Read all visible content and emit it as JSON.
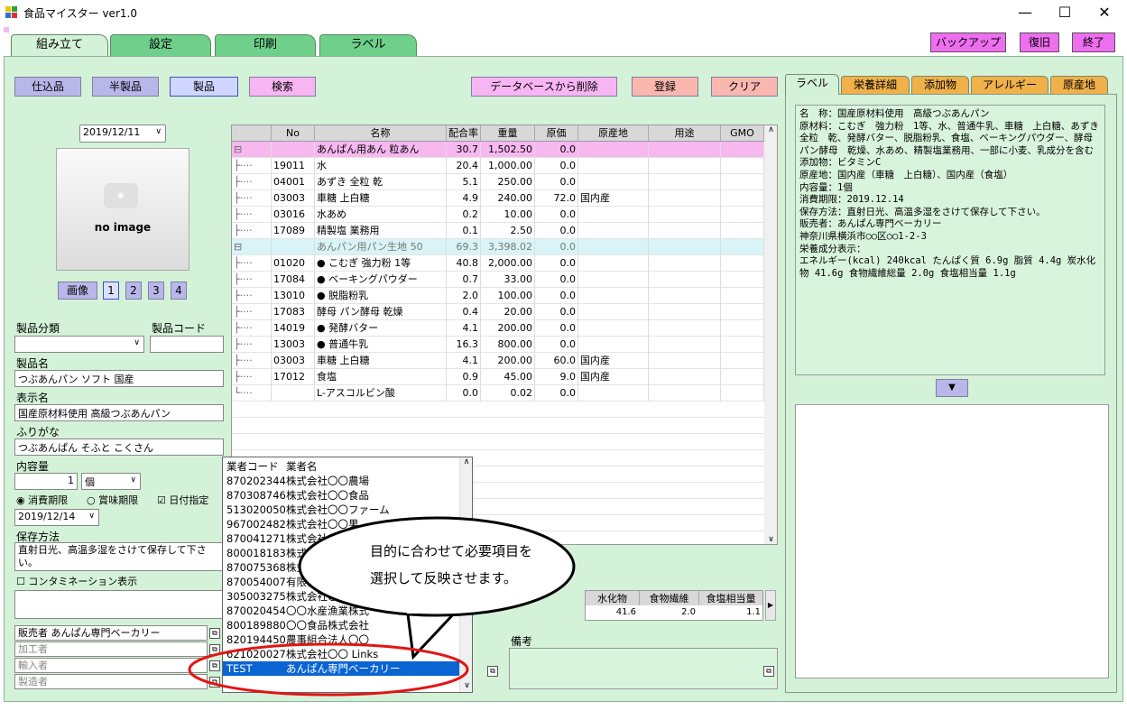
{
  "window": {
    "title": "食品マイスター ver1.0",
    "minimize": "—",
    "maximize": "☐",
    "close": "✕"
  },
  "tabs": [
    "組み立て",
    "設定",
    "印刷",
    "ラベル"
  ],
  "top_buttons": {
    "backup": "バックアップ",
    "restore": "復旧",
    "exit": "終了"
  },
  "left_buttons": [
    "仕込品",
    "半製品",
    "製品",
    "検索"
  ],
  "action_buttons": {
    "delete": "データベースから削除",
    "register": "登録",
    "clear": "クリア"
  },
  "date": "2019/12/11",
  "image": {
    "placeholder": "no image",
    "button": "画像",
    "pages": [
      "1",
      "2",
      "3",
      "4"
    ]
  },
  "form": {
    "category_label": "製品分類",
    "category_value": "",
    "code_label": "製品コード",
    "code_value": "",
    "name_label": "製品名",
    "name_value": "つぶあんパン ソフト 国産",
    "display_label": "表示名",
    "display_value": "国産原材料使用 高級つぶあんパン",
    "furigana_label": "ふりがな",
    "furigana_value": "つぶあんぱん そふと こくさん",
    "content_label": "内容量",
    "content_qty": "1",
    "content_unit": "個",
    "expiry_consume": "消費期限",
    "expiry_best": "賞味期限",
    "date_specify": "日付指定",
    "expiry_date": "2019/12/14",
    "storage_label": "保存方法",
    "storage_value": "直射日光、高温多湿をさけて保存して下さい。",
    "contamination_label": "コンタミネーション表示",
    "seller": "販売者 あんぱん専門ベーカリー",
    "processor": "加工者",
    "importer": "輸入者",
    "manufacturer": "製造者"
  },
  "grid": {
    "headers": [
      "No",
      "名称",
      "配合率",
      "重量",
      "原価",
      "原産地",
      "用途",
      "GMO"
    ],
    "rows": [
      {
        "type": "group1",
        "no": "",
        "name": "あんぱん用あん 粒あん",
        "rate": "30.7",
        "weight": "1,502.50",
        "cost": "0.0",
        "origin": ""
      },
      {
        "type": "child",
        "no": "19011",
        "name": "水",
        "rate": "20.4",
        "weight": "1,000.00",
        "cost": "0.0",
        "origin": ""
      },
      {
        "type": "child",
        "no": "04001",
        "name": "あずき 全粒 乾",
        "rate": "5.1",
        "weight": "250.00",
        "cost": "0.0",
        "origin": ""
      },
      {
        "type": "child",
        "no": "03003",
        "name": "車糖 上白糖",
        "rate": "4.9",
        "weight": "240.00",
        "cost": "72.0",
        "origin": "国内産"
      },
      {
        "type": "child",
        "no": "03016",
        "name": "水あめ",
        "rate": "0.2",
        "weight": "10.00",
        "cost": "0.0",
        "origin": ""
      },
      {
        "type": "child",
        "no": "17089",
        "name": "精製塩 業務用",
        "rate": "0.1",
        "weight": "2.50",
        "cost": "0.0",
        "origin": ""
      },
      {
        "type": "group2",
        "no": "",
        "name": "あんパン用パン生地 50",
        "rate": "69.3",
        "weight": "3,398.02",
        "cost": "0.0",
        "origin": ""
      },
      {
        "type": "child",
        "no": "01020",
        "name": "● こむぎ 強力粉 1等",
        "rate": "40.8",
        "weight": "2,000.00",
        "cost": "0.0",
        "origin": ""
      },
      {
        "type": "child",
        "no": "17084",
        "name": "● ベーキングパウダー",
        "rate": "0.7",
        "weight": "33.00",
        "cost": "0.0",
        "origin": ""
      },
      {
        "type": "child",
        "no": "13010",
        "name": "● 脱脂粉乳",
        "rate": "2.0",
        "weight": "100.00",
        "cost": "0.0",
        "origin": ""
      },
      {
        "type": "child",
        "no": "17083",
        "name": "酵母 パン酵母 乾燥",
        "rate": "0.4",
        "weight": "20.00",
        "cost": "0.0",
        "origin": ""
      },
      {
        "type": "child",
        "no": "14019",
        "name": "● 発酵バター",
        "rate": "4.1",
        "weight": "200.00",
        "cost": "0.0",
        "origin": ""
      },
      {
        "type": "child",
        "no": "13003",
        "name": "● 普通牛乳",
        "rate": "16.3",
        "weight": "800.00",
        "cost": "0.0",
        "origin": ""
      },
      {
        "type": "child",
        "no": "03003",
        "name": "車糖 上白糖",
        "rate": "4.1",
        "weight": "200.00",
        "cost": "60.0",
        "origin": "国内産"
      },
      {
        "type": "child",
        "no": "17012",
        "name": "食塩",
        "rate": "0.9",
        "weight": "45.00",
        "cost": "9.0",
        "origin": "国内産"
      },
      {
        "type": "child-last",
        "no": "",
        "name": "L-アスコルビン酸",
        "rate": "0.0",
        "weight": "0.02",
        "cost": "0.0",
        "origin": ""
      }
    ]
  },
  "nutrition": {
    "headers": [
      "水化物",
      "食物繊維",
      "食塩相当量"
    ],
    "values": [
      "41.6",
      "2.0",
      "1.1"
    ]
  },
  "memo_label": "備考",
  "right_tabs": [
    "ラベル",
    "栄養詳細",
    "添加物",
    "アレルギー",
    "原産地"
  ],
  "label_text": "名　称：国産原材料使用　高級つぶあんパン\n原材料：こむぎ　強力粉　1等、水、普通牛乳、車糖　上白糖、あずき　全粒　乾、発酵バター、脱脂粉乳、食塩、ベーキングパウダー、酵母　パン酵母　乾燥、水あめ、精製塩業務用、一部に小麦、乳成分を含む\n添加物：ビタミンC\n原産地：国内産（車糖　上白糖）、国内産（食塩）\n内容量：1個\n消費期限：2019.12.14\n保存方法：直射日光、高温多湿をさけて保存して下さい。\n販売者：あんぱん専門ベーカリー\n神奈川県横浜市○○区○○1-2-3\n栄養成分表示：\nエネルギー(kcal) 240kcal たんぱく質 6.9g 脂質 4.4g 炭水化物 41.6g 食物繊維総量 2.0g 食塩相当量 1.1g",
  "popup": {
    "col_code": "業者コード",
    "col_name": "業者名",
    "rows": [
      [
        "870202344",
        "株式会社〇〇農場"
      ],
      [
        "870308746",
        "株式会社〇〇食品"
      ],
      [
        "513020050",
        "株式会社〇〇ファーム"
      ],
      [
        "967002482",
        "株式会社〇〇果"
      ],
      [
        "870041271",
        "株式会社〇"
      ],
      [
        "800018183",
        "株式会社〇"
      ],
      [
        "870075368",
        "株式会社〇"
      ],
      [
        "870054007",
        "有限会社〇"
      ],
      [
        "305003275",
        "株式会社〇〇"
      ],
      [
        "870020454",
        "〇〇水産漁業株式"
      ],
      [
        "800189880",
        "〇〇食品株式会社"
      ],
      [
        "820194450",
        "農事組合法人〇〇"
      ],
      [
        "621020027",
        "株式会社〇〇 Links"
      ],
      [
        "TEST",
        "あんぱん専門ベーカリー"
      ]
    ]
  },
  "callout": "目的に合わせて必要項目を\n選択して反映させます。",
  "colors": {
    "panel": "#d4f2d8",
    "selected": "#0a64d2",
    "group1": "#f7b8f0",
    "group2": "#d8f4f6",
    "callout_ring": "#e31414"
  }
}
